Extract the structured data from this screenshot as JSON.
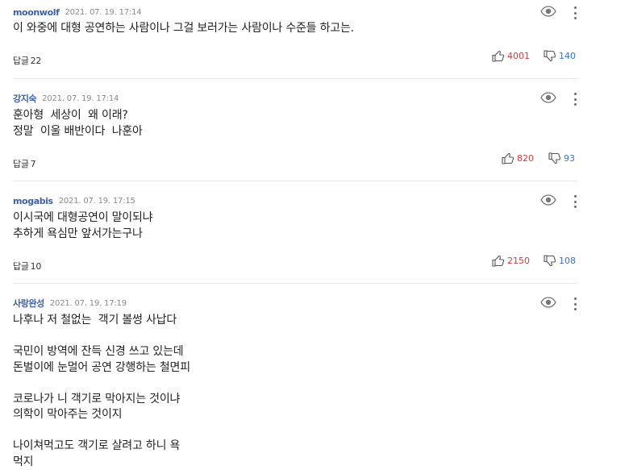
{
  "comments": [
    {
      "author": "moonwolf",
      "date": "2021. 07. 19. 17:14",
      "lines": [
        "이 와중에 대형 공연하는 사람이나 그걸 보러가는 사람이나 수준들 하고는."
      ],
      "reply_label": "답글",
      "reply_count": "22",
      "likes": "4001",
      "dislikes": "140"
    },
    {
      "author": "강지숙",
      "date": "2021. 07. 19. 17:14",
      "lines": [
        "훈아형  세상이  왜 이래?",
        "정말  이울 배반이다  나훈아"
      ],
      "reply_label": "답글",
      "reply_count": "7",
      "likes": "820",
      "dislikes": "93"
    },
    {
      "author": "mogabis",
      "date": "2021. 07. 19. 17:15",
      "lines": [
        "이시국에 대형공연이 말이되냐",
        "추하게 욕심만 앞서가는구나"
      ],
      "reply_label": "답글",
      "reply_count": "10",
      "likes": "2150",
      "dislikes": "108"
    },
    {
      "author": "사랑완성",
      "date": "2021. 07. 19. 17:19",
      "lines": [
        "나후나 저 철없는  객기 볼썽 사납다",
        "",
        "국민이 방역에 잔득 신경 쓰고 있는데",
        "돈벌이에 눈멀어 공연 강행하는 철면피",
        "",
        "코로나가 니 객기로 막아지는 것이냐",
        "의학이 막아주는 것이지",
        "",
        "나이쳐먹고도 객기로 살려고 하니 욕",
        "먹지"
      ]
    }
  ],
  "icons": {
    "view": "eye-icon",
    "more": "more-vert-icon",
    "like": "thumbs-up-icon",
    "dislike": "thumbs-down-icon"
  },
  "colors": {
    "author": "#3b5fa8",
    "likes": "#d63b3b",
    "dislikes": "#3b72c8",
    "divider": "#e6e6e6"
  }
}
